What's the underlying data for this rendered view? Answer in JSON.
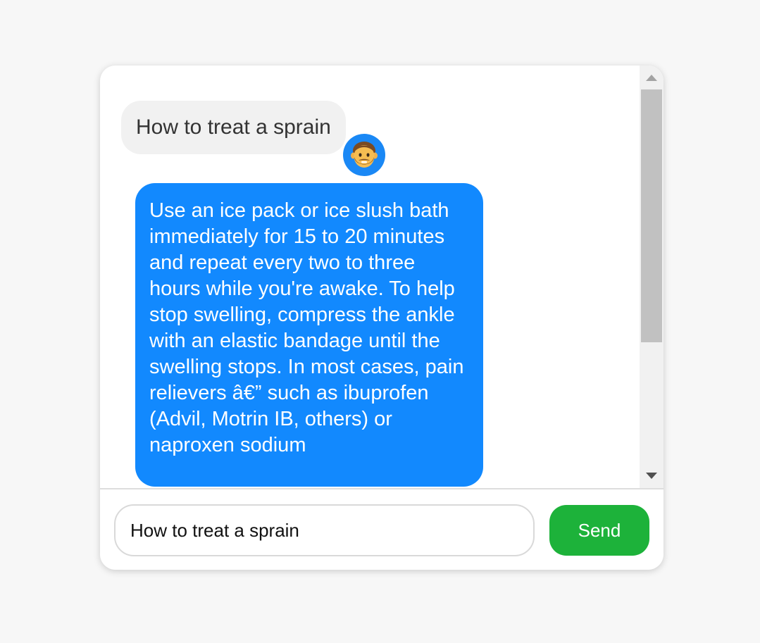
{
  "conversation": {
    "user_message": "How to treat a sprain",
    "bot_message": "Use an ice pack or ice slush bath immediately for 15 to 20 minutes and repeat every two to three hours while you're awake. To help stop swelling, compress the ankle with an elastic bandage until the swelling stops. In most cases, pain relievers â€” such as ibuprofen (Advil, Motrin IB, others) or naproxen sodium",
    "avatar_icon": "man-face-emoji-icon"
  },
  "composer": {
    "input_value": "How to treat a sprain",
    "send_label": "Send"
  },
  "colors": {
    "user_bubble": "#f1f1f1",
    "bot_bubble": "#1289fe",
    "avatar_bg": "#1a88f5",
    "send_button": "#1db23a"
  }
}
